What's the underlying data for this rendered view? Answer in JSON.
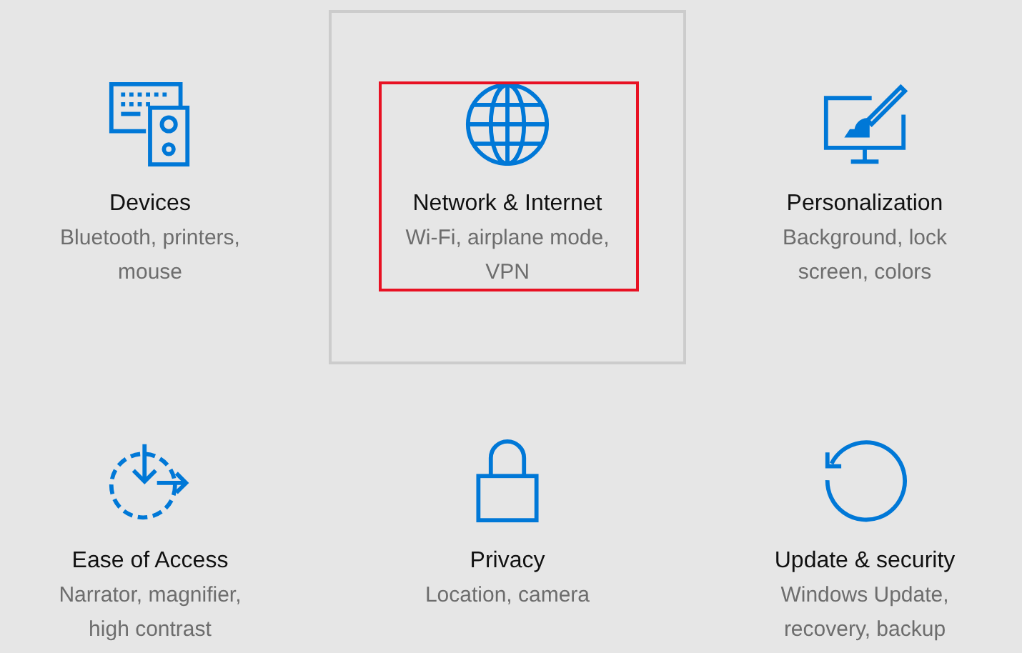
{
  "tiles": [
    {
      "kind": "devices",
      "title": "Devices",
      "description": "Bluetooth, printers, mouse",
      "selected": false,
      "highlighted": false
    },
    {
      "kind": "network",
      "title": "Network & Internet",
      "description": "Wi-Fi, airplane mode, VPN",
      "selected": true,
      "highlighted": true
    },
    {
      "kind": "personalization",
      "title": "Personalization",
      "description": "Background, lock screen, colors",
      "selected": false,
      "highlighted": false
    },
    {
      "kind": "ease",
      "title": "Ease of Access",
      "description": "Narrator, magnifier, high contrast",
      "selected": false,
      "highlighted": false
    },
    {
      "kind": "privacy",
      "title": "Privacy",
      "description": "Location, camera",
      "selected": false,
      "highlighted": false
    },
    {
      "kind": "update",
      "title": "Update & security",
      "description": "Windows Update, recovery, backup",
      "selected": false,
      "highlighted": false
    }
  ]
}
